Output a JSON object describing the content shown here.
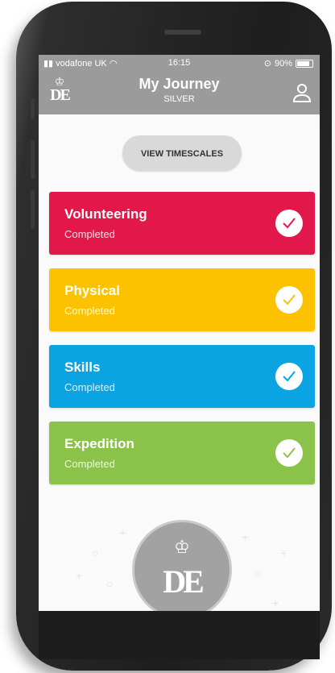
{
  "status_bar": {
    "carrier": "vodafone UK",
    "time": "16:15",
    "battery": "90%"
  },
  "header": {
    "title": "My Journey",
    "subtitle": "SILVER"
  },
  "actions": {
    "view_timescales": "VIEW TIMESCALES"
  },
  "sections": [
    {
      "name": "Volunteering",
      "status": "Completed",
      "color": "#e2184a"
    },
    {
      "name": "Physical",
      "status": "Completed",
      "color": "#fcc200"
    },
    {
      "name": "Skills",
      "status": "Completed",
      "color": "#0aa4e3"
    },
    {
      "name": "Expedition",
      "status": "Completed",
      "color": "#8bc34a"
    }
  ],
  "icons": [
    "signal-icon",
    "wifi-icon",
    "battery-icon",
    "dofe-logo",
    "profile-icon",
    "check-icon"
  ]
}
